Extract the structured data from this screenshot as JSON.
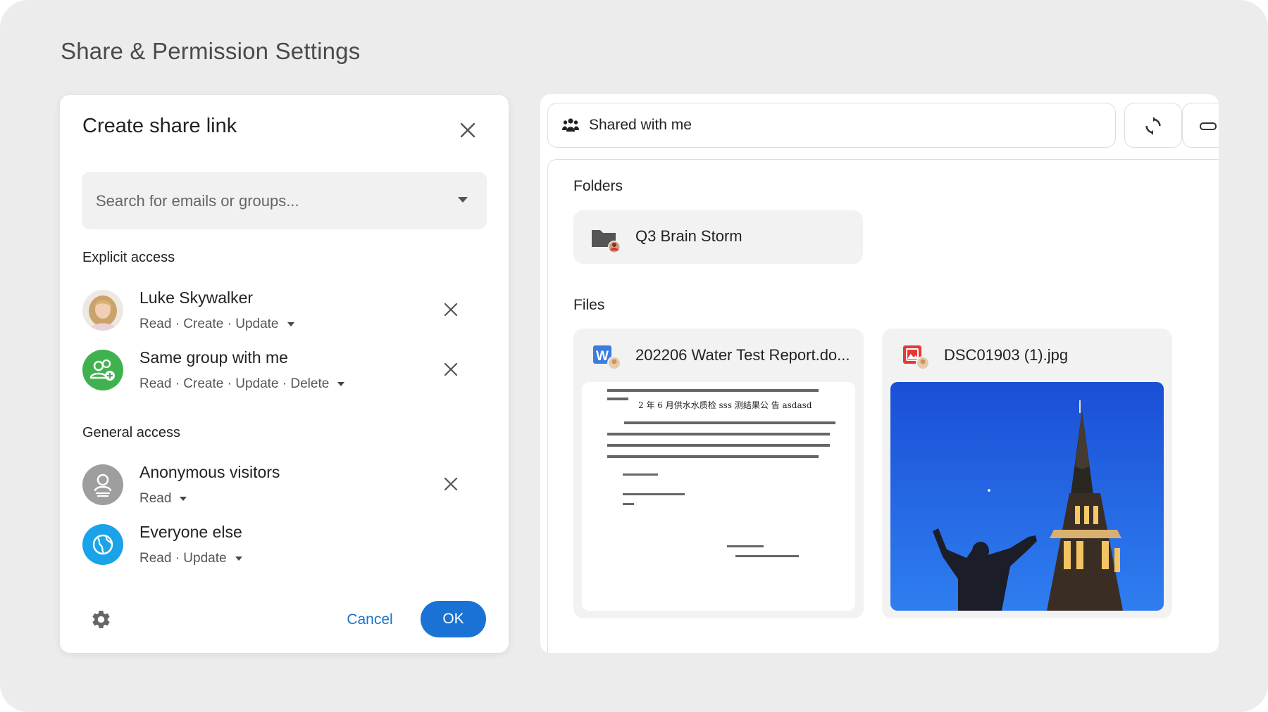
{
  "page_title": "Share & Permission Settings",
  "dialog": {
    "title": "Create share link",
    "search_placeholder": "Search for emails or groups...",
    "explicit_label": "Explicit access",
    "explicit": [
      {
        "name": "Luke Skywalker",
        "permissions": "Read · Create · Update",
        "avatar": "user-photo"
      },
      {
        "name": "Same group with me",
        "permissions": "Read · Create · Update · Delete",
        "avatar": "group-icon"
      }
    ],
    "general_label": "General access",
    "general": [
      {
        "name": "Anonymous visitors",
        "permissions": "Read",
        "avatar": "anonymous-icon"
      },
      {
        "name": "Everyone else",
        "permissions": "Read · Update",
        "avatar": "globe-icon"
      }
    ],
    "cancel_label": "Cancel",
    "ok_label": "OK"
  },
  "panel": {
    "title": "Shared with me",
    "folders_label": "Folders",
    "folders": [
      {
        "name": "Q3 Brain Storm"
      }
    ],
    "files_label": "Files",
    "files": [
      {
        "name": "202206 Water Test Report.do...",
        "type": "word-document-icon"
      },
      {
        "name": "DSC01903 (1).jpg",
        "type": "image-file-icon"
      }
    ],
    "doc_preview_heading": "2 年 6 月供水水质检 sss 测结果公 告 asdasd"
  },
  "colors": {
    "accent": "#1a73d4",
    "group_green": "#3fb24f",
    "anonymous_gray": "#9e9e9e",
    "globe_blue": "#1aa3e8"
  }
}
